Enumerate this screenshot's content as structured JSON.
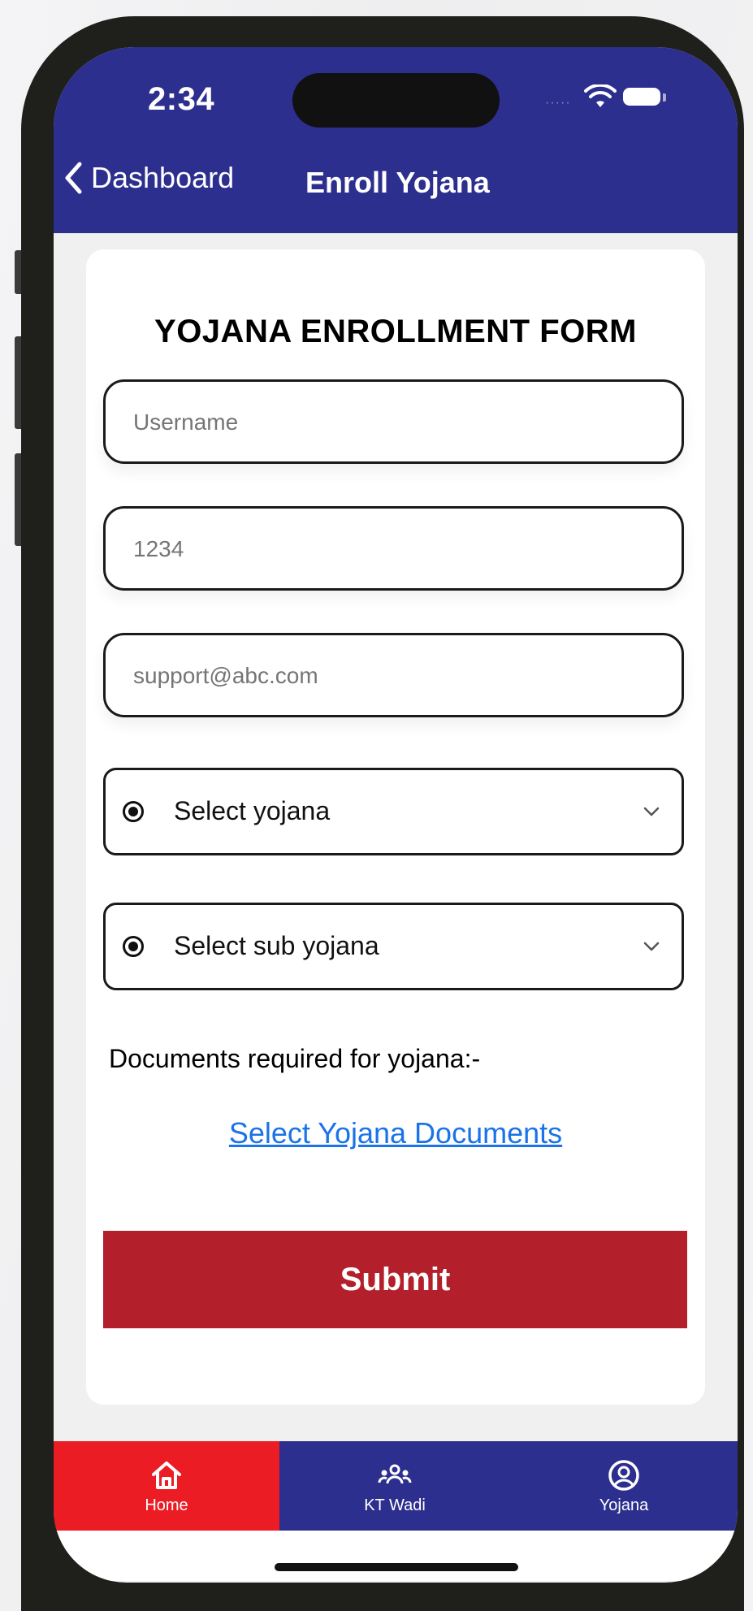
{
  "status_bar": {
    "time": "2:34"
  },
  "nav": {
    "back_label": "Dashboard",
    "title": "Enroll Yojana"
  },
  "form": {
    "title": "YOJANA ENROLLMENT FORM",
    "fields": {
      "username": {
        "value": "",
        "placeholder": "Username"
      },
      "number": {
        "value": "",
        "placeholder": "1234"
      },
      "email": {
        "value": "",
        "placeholder": "support@abc.com"
      }
    },
    "select_yojana": {
      "label": "Select yojana"
    },
    "select_sub_yojana": {
      "label": "Select sub yojana"
    },
    "documents_label": "Documents required for yojana:-",
    "documents_link": "Select Yojana Documents",
    "submit_label": "Submit"
  },
  "tabbar": {
    "tabs": [
      {
        "label": "Home",
        "icon": "home-icon",
        "active": true
      },
      {
        "label": "KT Wadi",
        "icon": "group-icon",
        "active": false
      },
      {
        "label": "Yojana",
        "icon": "user-circle-icon",
        "active": false
      }
    ]
  },
  "colors": {
    "header_bg": "#2d2f8f",
    "active_tab_bg": "#ec1c24",
    "submit_bg": "#b3202b",
    "link": "#1a73e8"
  }
}
